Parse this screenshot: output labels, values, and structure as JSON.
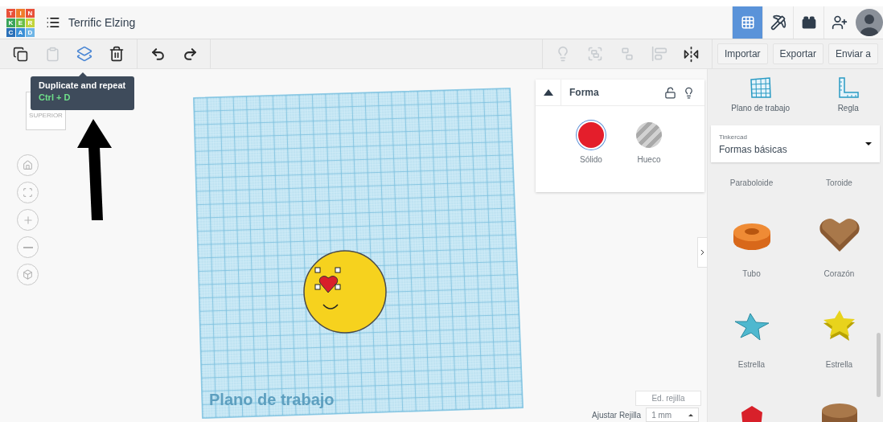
{
  "header": {
    "logo_letters": [
      "T",
      "I",
      "N",
      "K",
      "E",
      "R",
      "C",
      "A",
      "D"
    ],
    "title": "Terrific Elzing",
    "view_tabs": [
      {
        "kind": "grid",
        "selected": true
      },
      {
        "kind": "pickaxe",
        "selected": false
      },
      {
        "kind": "bricks",
        "selected": false
      },
      {
        "kind": "add-user",
        "selected": false
      }
    ]
  },
  "toolbar": {
    "edit_tools": [
      {
        "kind": "copy",
        "disabled": false,
        "highlighted": false
      },
      {
        "kind": "paste",
        "disabled": true,
        "highlighted": false
      },
      {
        "kind": "duplicate",
        "disabled": false,
        "highlighted": true
      },
      {
        "kind": "delete",
        "disabled": false,
        "highlighted": false
      }
    ],
    "history_tools": [
      {
        "kind": "undo"
      },
      {
        "kind": "redo"
      }
    ],
    "view_tools": [
      {
        "kind": "note",
        "disabled": true
      },
      {
        "kind": "group",
        "disabled": true
      },
      {
        "kind": "ungroup",
        "disabled": true
      },
      {
        "kind": "align",
        "disabled": true
      },
      {
        "kind": "mirror",
        "disabled": false
      }
    ],
    "buttons": [
      "Importar",
      "Exportar",
      "Enviar a"
    ]
  },
  "tooltip": {
    "title": "Duplicate and repeat",
    "shortcut": "Ctrl + D"
  },
  "view_cube": {
    "label": "SUPERIOR"
  },
  "nav_controls": [
    {
      "kind": "home"
    },
    {
      "kind": "fit"
    },
    {
      "kind": "zoom-in"
    },
    {
      "kind": "zoom-out"
    },
    {
      "kind": "perspective"
    }
  ],
  "workplane": {
    "label": "Plano de trabajo"
  },
  "shape_panel": {
    "title": "Forma",
    "locked": false,
    "options": [
      {
        "label": "Sólido",
        "kind": "solid",
        "selected": true
      },
      {
        "label": "Hueco",
        "kind": "hole",
        "selected": false
      }
    ]
  },
  "grid_controls": {
    "edit_button": "Ed. rejilla",
    "snap_label": "Ajustar Rejilla",
    "snap_value": "1 mm"
  },
  "library": {
    "tools": [
      {
        "label": "Plano de trabajo",
        "kind": "workplane"
      },
      {
        "label": "Regla",
        "kind": "ruler"
      }
    ],
    "source_label": "Tinkercad",
    "category": "Formas básicas",
    "shapes": [
      {
        "label": "Paraboloide",
        "kind": "paraboloid"
      },
      {
        "label": "Toroide"
      },
      {
        "label": "Tubo",
        "kind": "tube"
      },
      {
        "label": "Corazón",
        "kind": "heart"
      },
      {
        "label": "Estrella",
        "kind": "star-pyramid"
      },
      {
        "label": "Estrella",
        "kind": "star"
      },
      {
        "kind": "gem"
      },
      {
        "kind": "cylinder"
      }
    ]
  }
}
